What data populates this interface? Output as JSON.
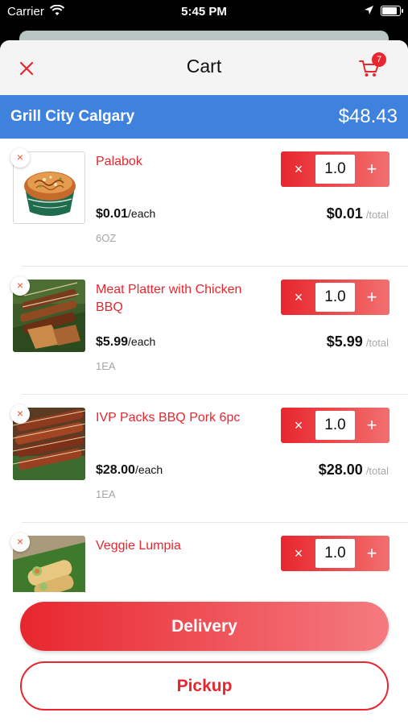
{
  "status_bar": {
    "carrier": "Carrier",
    "time": "5:45 PM",
    "wifi_icon": "wifi-icon",
    "location_icon": "location-arrow-icon",
    "battery_icon": "battery-icon"
  },
  "header": {
    "title": "Cart",
    "close_icon": "close-icon",
    "cart_icon": "shopping-cart-icon",
    "cart_badge": "7"
  },
  "store": {
    "name": "Grill City Calgary",
    "total": "$48.43"
  },
  "items": [
    {
      "name": "Palabok",
      "unit_price": "$0.01",
      "unit_suffix": "/each",
      "unit": "6OZ",
      "quantity": "1.0",
      "line_total": "$0.01",
      "total_suffix": "/total"
    },
    {
      "name": "Meat Platter with Chicken BBQ",
      "unit_price": "$5.99",
      "unit_suffix": "/each",
      "unit": "1EA",
      "quantity": "1.0",
      "line_total": "$5.99",
      "total_suffix": "/total"
    },
    {
      "name": "IVP Packs BBQ Pork 6pc",
      "unit_price": "$28.00",
      "unit_suffix": "/each",
      "unit": "1EA",
      "quantity": "1.0",
      "line_total": "$28.00",
      "total_suffix": "/total"
    },
    {
      "name": "Veggie Lumpia",
      "unit_price": "",
      "unit_suffix": "",
      "unit": "",
      "quantity": "1.0",
      "line_total": "",
      "total_suffix": ""
    }
  ],
  "qty_controls": {
    "minus": "×",
    "plus": "+"
  },
  "remove_label": "×",
  "actions": {
    "delivery": "Delivery",
    "pickup": "Pickup"
  },
  "colors": {
    "accent": "#e8262e",
    "store_bar": "#3e82dd"
  }
}
